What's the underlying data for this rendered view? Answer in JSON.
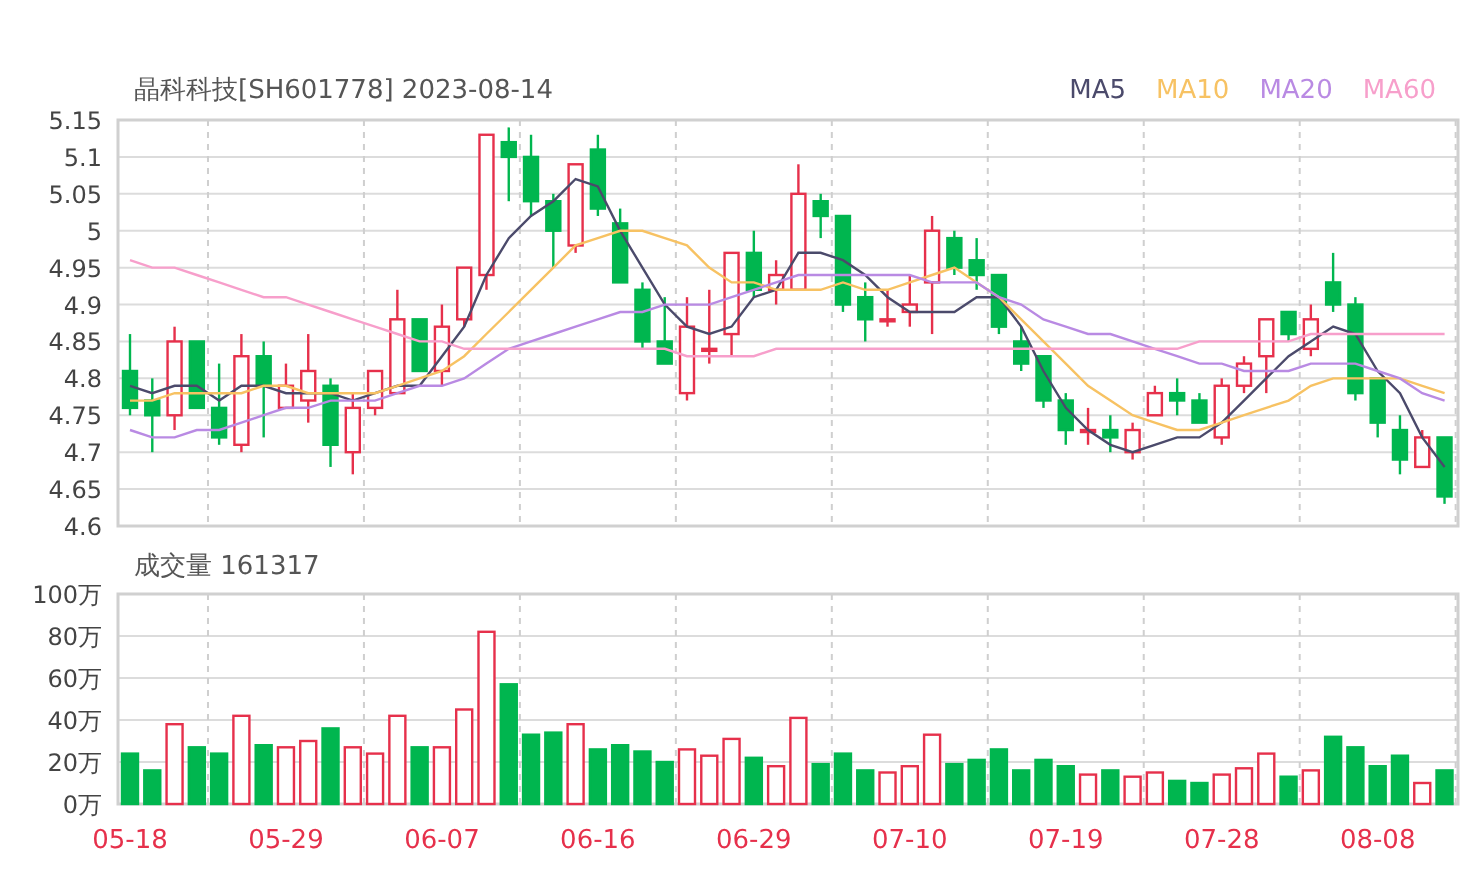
{
  "price_chart": {
    "chart_data": {
      "type": "candlestick",
      "title": "晶科科技[SH601778] 2023-08-14",
      "grid": true,
      "ylim": [
        4.6,
        5.15
      ],
      "yticks": [
        4.6,
        4.65,
        4.7,
        4.75,
        4.8,
        4.85,
        4.9,
        4.95,
        5,
        5.05,
        5.1,
        5.15
      ],
      "categories": [
        null,
        null,
        null,
        null,
        null,
        null,
        null,
        null,
        null,
        null,
        null,
        null,
        null,
        null,
        null,
        null,
        null,
        null,
        null,
        null,
        null,
        null,
        null,
        null,
        null,
        null,
        null,
        null,
        null,
        null,
        null,
        null,
        null,
        null,
        null,
        null,
        null,
        null,
        null,
        null,
        null,
        null,
        null,
        null,
        null,
        null,
        null,
        null,
        null,
        null,
        null,
        null,
        null,
        null,
        null,
        null,
        null,
        null,
        null,
        null
      ],
      "ohlc": [
        [
          4.81,
          4.86,
          4.75,
          4.76
        ],
        [
          4.77,
          4.8,
          4.7,
          4.75
        ],
        [
          4.75,
          4.87,
          4.73,
          4.85
        ],
        [
          4.85,
          4.85,
          4.76,
          4.76
        ],
        [
          4.76,
          4.82,
          4.71,
          4.72
        ],
        [
          4.71,
          4.86,
          4.7,
          4.83
        ],
        [
          4.83,
          4.85,
          4.72,
          4.79
        ],
        [
          4.76,
          4.82,
          4.76,
          4.79
        ],
        [
          4.77,
          4.86,
          4.74,
          4.81
        ],
        [
          4.79,
          4.8,
          4.68,
          4.71
        ],
        [
          4.7,
          4.78,
          4.67,
          4.76
        ],
        [
          4.76,
          4.81,
          4.75,
          4.81
        ],
        [
          4.78,
          4.92,
          4.78,
          4.88
        ],
        [
          4.88,
          4.88,
          4.81,
          4.81
        ],
        [
          4.81,
          4.9,
          4.79,
          4.87
        ],
        [
          4.88,
          4.95,
          4.87,
          4.95
        ],
        [
          4.94,
          5.13,
          4.92,
          5.13
        ],
        [
          5.12,
          5.14,
          5.04,
          5.1
        ],
        [
          5.1,
          5.13,
          5.02,
          5.04
        ],
        [
          5.04,
          5.05,
          4.95,
          5.0
        ],
        [
          4.98,
          5.09,
          4.97,
          5.09
        ],
        [
          5.11,
          5.13,
          5.02,
          5.03
        ],
        [
          5.01,
          5.03,
          4.93,
          4.93
        ],
        [
          4.92,
          4.93,
          4.84,
          4.85
        ],
        [
          4.85,
          4.91,
          4.82,
          4.82
        ],
        [
          4.78,
          4.91,
          4.77,
          4.87
        ],
        [
          4.84,
          4.92,
          4.82,
          4.84
        ],
        [
          4.86,
          4.97,
          4.83,
          4.97
        ],
        [
          4.97,
          5.0,
          4.91,
          4.92
        ],
        [
          4.92,
          4.96,
          4.9,
          4.94
        ],
        [
          4.92,
          5.09,
          4.92,
          5.05
        ],
        [
          5.04,
          5.05,
          4.99,
          5.02
        ],
        [
          5.02,
          5.02,
          4.89,
          4.9
        ],
        [
          4.91,
          4.93,
          4.85,
          4.88
        ],
        [
          4.88,
          4.92,
          4.87,
          4.88
        ],
        [
          4.89,
          4.94,
          4.87,
          4.9
        ],
        [
          4.93,
          5.02,
          4.86,
          5.0
        ],
        [
          4.99,
          5.0,
          4.94,
          4.95
        ],
        [
          4.96,
          4.99,
          4.92,
          4.94
        ],
        [
          4.94,
          4.94,
          4.86,
          4.87
        ],
        [
          4.85,
          4.87,
          4.81,
          4.82
        ],
        [
          4.83,
          4.83,
          4.76,
          4.77
        ],
        [
          4.77,
          4.78,
          4.71,
          4.73
        ],
        [
          4.73,
          4.76,
          4.71,
          4.73
        ],
        [
          4.73,
          4.75,
          4.7,
          4.72
        ],
        [
          4.7,
          4.74,
          4.69,
          4.73
        ],
        [
          4.75,
          4.79,
          4.75,
          4.78
        ],
        [
          4.78,
          4.8,
          4.75,
          4.77
        ],
        [
          4.77,
          4.78,
          4.74,
          4.74
        ],
        [
          4.72,
          4.8,
          4.71,
          4.79
        ],
        [
          4.79,
          4.83,
          4.78,
          4.82
        ],
        [
          4.83,
          4.88,
          4.78,
          4.88
        ],
        [
          4.89,
          4.89,
          4.85,
          4.86
        ],
        [
          4.84,
          4.9,
          4.83,
          4.88
        ],
        [
          4.93,
          4.97,
          4.89,
          4.9
        ],
        [
          4.9,
          4.91,
          4.77,
          4.78
        ],
        [
          4.8,
          4.8,
          4.72,
          4.74
        ],
        [
          4.73,
          4.75,
          4.67,
          4.69
        ],
        [
          4.68,
          4.73,
          4.68,
          4.72
        ],
        [
          4.72,
          4.72,
          4.63,
          4.64
        ]
      ],
      "series": [
        {
          "name": "MA5",
          "type": "line",
          "color": "#4b4a6b",
          "values": [
            4.79,
            4.78,
            4.79,
            4.79,
            4.77,
            4.79,
            4.79,
            4.78,
            4.78,
            4.78,
            4.77,
            4.78,
            4.79,
            4.79,
            4.83,
            4.87,
            4.94,
            4.99,
            5.02,
            5.04,
            5.07,
            5.06,
            5.0,
            4.95,
            4.9,
            4.87,
            4.86,
            4.87,
            4.91,
            4.92,
            4.97,
            4.97,
            4.96,
            4.94,
            4.91,
            4.89,
            4.89,
            4.89,
            4.91,
            4.91,
            4.87,
            4.81,
            4.76,
            4.73,
            4.71,
            4.7,
            4.71,
            4.72,
            4.72,
            4.74,
            4.77,
            4.8,
            4.83,
            4.85,
            4.87,
            4.86,
            4.81,
            4.78,
            4.72,
            4.68
          ]
        },
        {
          "name": "MA10",
          "type": "line",
          "color": "#f7c263",
          "values": [
            4.77,
            4.77,
            4.78,
            4.78,
            4.78,
            4.78,
            4.79,
            4.79,
            4.78,
            4.78,
            4.78,
            4.78,
            4.79,
            4.8,
            4.81,
            4.83,
            4.86,
            4.89,
            4.92,
            4.95,
            4.98,
            4.99,
            5.0,
            5.0,
            4.99,
            4.98,
            4.95,
            4.93,
            4.93,
            4.92,
            4.92,
            4.92,
            4.93,
            4.92,
            4.92,
            4.93,
            4.94,
            4.95,
            4.93,
            4.91,
            4.88,
            4.85,
            4.82,
            4.79,
            4.77,
            4.75,
            4.74,
            4.73,
            4.73,
            4.74,
            4.75,
            4.76,
            4.77,
            4.79,
            4.8,
            4.8,
            4.8,
            4.8,
            4.79,
            4.78
          ]
        },
        {
          "name": "MA20",
          "type": "line",
          "color": "#b98ae3",
          "values": [
            4.73,
            4.72,
            4.72,
            4.73,
            4.73,
            4.74,
            4.75,
            4.76,
            4.76,
            4.77,
            4.77,
            4.77,
            4.78,
            4.79,
            4.79,
            4.8,
            4.82,
            4.84,
            4.85,
            4.86,
            4.87,
            4.88,
            4.89,
            4.89,
            4.9,
            4.9,
            4.9,
            4.91,
            4.92,
            4.93,
            4.94,
            4.94,
            4.94,
            4.94,
            4.94,
            4.94,
            4.93,
            4.93,
            4.93,
            4.91,
            4.9,
            4.88,
            4.87,
            4.86,
            4.86,
            4.85,
            4.84,
            4.83,
            4.82,
            4.82,
            4.81,
            4.81,
            4.81,
            4.82,
            4.82,
            4.82,
            4.81,
            4.8,
            4.78,
            4.77
          ]
        },
        {
          "name": "MA60",
          "type": "line",
          "color": "#f79fcb",
          "values": [
            4.96,
            4.95,
            4.95,
            4.94,
            4.93,
            4.92,
            4.91,
            4.91,
            4.9,
            4.89,
            4.88,
            4.87,
            4.86,
            4.85,
            4.85,
            4.84,
            4.84,
            4.84,
            4.84,
            4.84,
            4.84,
            4.84,
            4.84,
            4.84,
            4.84,
            4.83,
            4.83,
            4.83,
            4.83,
            4.84,
            4.84,
            4.84,
            4.84,
            4.84,
            4.84,
            4.84,
            4.84,
            4.84,
            4.84,
            4.84,
            4.84,
            4.84,
            4.84,
            4.84,
            4.84,
            4.84,
            4.84,
            4.84,
            4.85,
            4.85,
            4.85,
            4.85,
            4.85,
            4.86,
            4.86,
            4.86,
            4.86,
            4.86,
            4.86,
            4.86
          ]
        }
      ]
    }
  },
  "volume_chart": {
    "chart_data": {
      "type": "bar",
      "title": "成交量 161317",
      "grid": true,
      "ylim": [
        0,
        100
      ],
      "yticks": [
        {
          "value": 0,
          "label": "0万"
        },
        {
          "value": 20,
          "label": "20万"
        },
        {
          "value": 40,
          "label": "40万"
        },
        {
          "value": 60,
          "label": "60万"
        },
        {
          "value": 80,
          "label": "80万"
        },
        {
          "value": 100,
          "label": "100万"
        }
      ],
      "categories": [
        "05-18",
        null,
        null,
        null,
        null,
        null,
        null,
        "05-29",
        null,
        null,
        null,
        null,
        null,
        null,
        "06-07",
        null,
        null,
        null,
        null,
        null,
        null,
        "06-16",
        null,
        null,
        null,
        null,
        null,
        null,
        "06-29",
        null,
        null,
        null,
        null,
        null,
        null,
        "07-10",
        null,
        null,
        null,
        null,
        null,
        null,
        "07-19",
        null,
        null,
        null,
        null,
        null,
        null,
        "07-28",
        null,
        null,
        null,
        null,
        null,
        null,
        "08-08",
        null,
        null,
        null
      ],
      "values": [
        24,
        16,
        38,
        27,
        24,
        42,
        28,
        27,
        30,
        36,
        27,
        24,
        42,
        27,
        27,
        45,
        82,
        57,
        33,
        34,
        38,
        26,
        28,
        25,
        20,
        26,
        23,
        31,
        22,
        18,
        41,
        19,
        24,
        16,
        15,
        18,
        33,
        19,
        21,
        26,
        16,
        21,
        18,
        14,
        16,
        13,
        15,
        11,
        10,
        14,
        17,
        24,
        13,
        16,
        32,
        27,
        18,
        23,
        10,
        16
      ]
    }
  }
}
